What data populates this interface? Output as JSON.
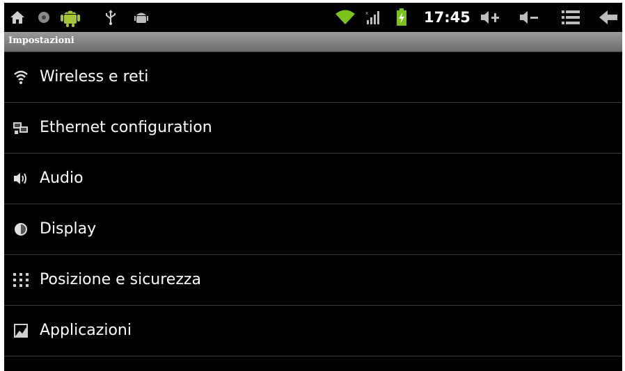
{
  "status_bar": {
    "time": "17:45",
    "icons_left": [
      "home-icon",
      "record-icon",
      "android-icon",
      "usb-icon",
      "android-debug-icon"
    ],
    "icons_right": [
      "wifi-icon",
      "signal-icon",
      "battery-charging-icon",
      "volume-up-icon",
      "volume-down-icon",
      "menu-icon",
      "back-icon"
    ]
  },
  "title": "Impostazioni",
  "settings": {
    "items": [
      {
        "label": "Wireless e reti",
        "icon": "wifi-icon"
      },
      {
        "label": "Ethernet configuration",
        "icon": "ethernet-icon"
      },
      {
        "label": "Audio",
        "icon": "speaker-icon"
      },
      {
        "label": "Display",
        "icon": "brightness-icon"
      },
      {
        "label": "Posizione e sicurezza",
        "icon": "location-grid-icon"
      },
      {
        "label": "Applicazioni",
        "icon": "applications-icon"
      }
    ]
  },
  "colors": {
    "background": "#000000",
    "title_bar": "#8a8a8a",
    "android_green": "#a4c639",
    "wifi_green": "#7cc21c",
    "text": "#ffffff"
  }
}
